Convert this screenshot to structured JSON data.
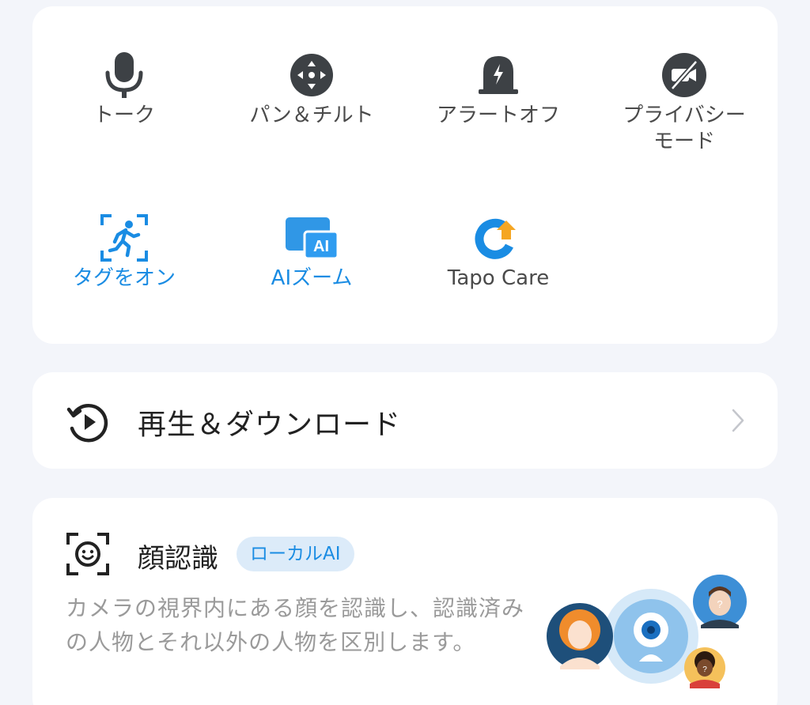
{
  "controls": [
    {
      "label": "トーク",
      "icon": "microphone-icon",
      "active": false
    },
    {
      "label": "パン＆チルト",
      "icon": "pan-tilt-icon",
      "active": false
    },
    {
      "label": "アラートオフ",
      "icon": "alarm-off-icon",
      "active": false
    },
    {
      "label": "プライバシー\nモード",
      "icon": "privacy-mode-icon",
      "active": false
    },
    {
      "label": "タグをオン",
      "icon": "tag-person-icon",
      "active": true
    },
    {
      "label": "AIズーム",
      "icon": "ai-zoom-icon",
      "active": true
    },
    {
      "label": "Tapo Care",
      "icon": "tapo-care-icon",
      "active": false
    }
  ],
  "playback": {
    "label": "再生＆ダウンロード"
  },
  "face": {
    "title": "顔認識",
    "badge": "ローカルAI",
    "description": "カメラの視界内にある顔を認識し、認識済みの人物とそれ以外の人物を区別します。"
  },
  "colors": {
    "accent": "#1a8ce3",
    "icon_gray": "#3d4145",
    "background": "#f3f5fa",
    "card": "#ffffff",
    "tapo_orange": "#f5a623"
  }
}
